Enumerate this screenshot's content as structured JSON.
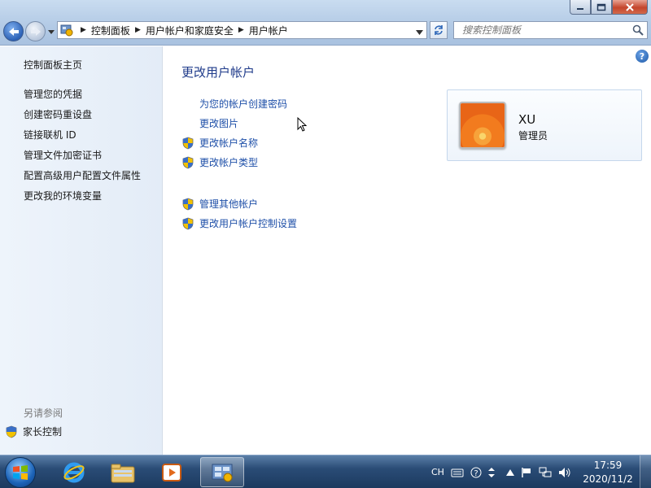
{
  "address": {
    "breadcrumbs": [
      "控制面板",
      "用户帐户和家庭安全",
      "用户帐户"
    ]
  },
  "search": {
    "placeholder": "搜索控制面板"
  },
  "sidebar": {
    "items": [
      {
        "label": "控制面板主页"
      },
      {
        "label": "管理您的凭据"
      },
      {
        "label": "创建密码重设盘"
      },
      {
        "label": "链接联机 ID"
      },
      {
        "label": "管理文件加密证书"
      },
      {
        "label": "配置高级用户配置文件属性"
      },
      {
        "label": "更改我的环境变量"
      }
    ],
    "see_also_heading": "另请参阅",
    "see_also_items": [
      {
        "label": "家长控制"
      }
    ]
  },
  "main": {
    "heading": "更改用户帐户",
    "tasks": [
      {
        "label": "为您的帐户创建密码",
        "icon": "none"
      },
      {
        "label": "更改图片",
        "icon": "none"
      },
      {
        "label": "更改帐户名称",
        "icon": "uac-shield-icon"
      },
      {
        "label": "更改帐户类型",
        "icon": "uac-shield-icon"
      }
    ],
    "other_tasks": [
      {
        "label": "管理其他帐户",
        "icon": "uac-shield-icon"
      },
      {
        "label": "更改用户帐户控制设置",
        "icon": "uac-shield-icon"
      }
    ]
  },
  "user": {
    "name": "XU",
    "role": "管理员"
  },
  "tray": {
    "lang": "CH"
  },
  "clock": {
    "time": "17:59",
    "date": "2020/11/2"
  },
  "colors": {
    "link": "#1e4fa8",
    "heading": "#1e3a8a",
    "taskbar": "#2a4c76"
  }
}
